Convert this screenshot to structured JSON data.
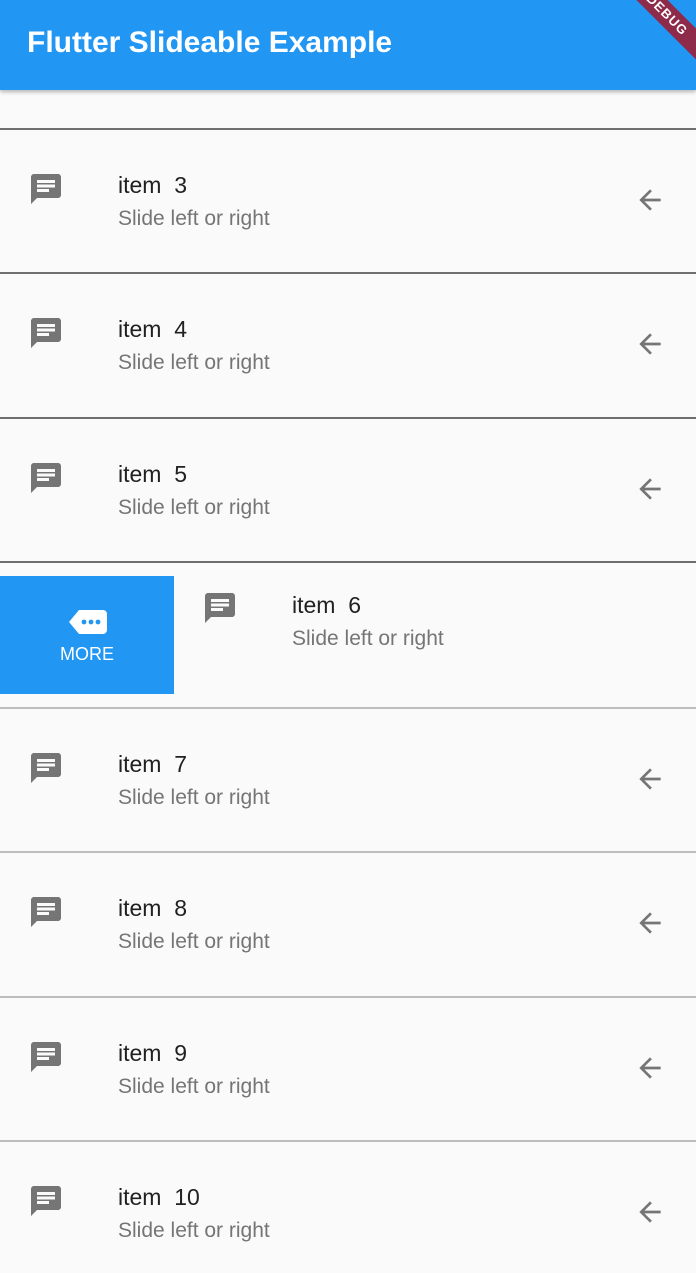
{
  "app_bar": {
    "title": "Flutter Slideable Example",
    "banner": "DEBUG",
    "color": "#2196f3"
  },
  "list": {
    "items": [
      {
        "title": "item  3",
        "subtitle": "Slide left or right",
        "lead_icon": "message-icon",
        "trail_icon": "arrow-back-icon"
      },
      {
        "title": "item  4",
        "subtitle": "Slide left or right",
        "lead_icon": "message-icon",
        "trail_icon": "arrow-back-icon"
      },
      {
        "title": "item  5",
        "subtitle": "Slide left or right",
        "lead_icon": "message-icon",
        "trail_icon": "arrow-back-icon"
      },
      {
        "title": "item  6",
        "subtitle": "Slide left or right",
        "lead_icon": "message-icon",
        "revealed_action": {
          "label": "MORE",
          "icon": "more-chat-icon",
          "color": "#2196f3"
        }
      },
      {
        "title": "item  7",
        "subtitle": "Slide left or right",
        "lead_icon": "message-icon",
        "trail_icon": "arrow-back-icon"
      },
      {
        "title": "item  8",
        "subtitle": "Slide left or right",
        "lead_icon": "message-icon",
        "trail_icon": "arrow-back-icon"
      },
      {
        "title": "item  9",
        "subtitle": "Slide left or right",
        "lead_icon": "message-icon",
        "trail_icon": "arrow-back-icon"
      },
      {
        "title": "item  10",
        "subtitle": "Slide left or right",
        "lead_icon": "message-icon",
        "trail_icon": "arrow-back-icon"
      }
    ]
  }
}
